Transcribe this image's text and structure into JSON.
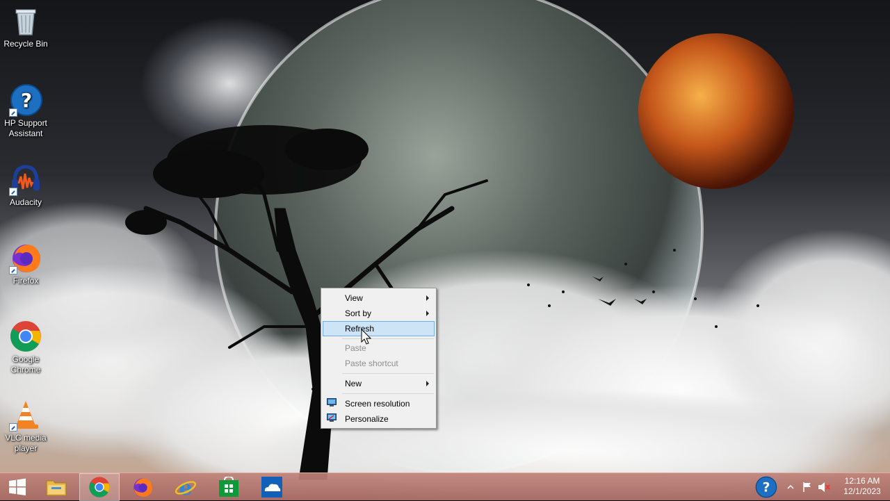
{
  "desktop": {
    "icons": [
      {
        "label": "Recycle Bin",
        "icon": "recycle-bin-icon"
      },
      {
        "label": "HP Support Assistant",
        "icon": "help-question-icon"
      },
      {
        "label": "Audacity",
        "icon": "audacity-icon"
      },
      {
        "label": "Firefox",
        "icon": "firefox-icon"
      },
      {
        "label": "Google Chrome",
        "icon": "chrome-icon"
      },
      {
        "label": "VLC media player",
        "icon": "vlc-cone-icon"
      }
    ]
  },
  "context_menu": {
    "items": [
      {
        "label": "View",
        "submenu": true,
        "disabled": false
      },
      {
        "label": "Sort by",
        "submenu": true,
        "disabled": false
      },
      {
        "label": "Refresh",
        "submenu": false,
        "disabled": false,
        "highlighted": true
      },
      {
        "label": "Paste",
        "submenu": false,
        "disabled": true
      },
      {
        "label": "Paste shortcut",
        "submenu": false,
        "disabled": true
      },
      {
        "label": "New",
        "submenu": true,
        "disabled": false
      },
      {
        "label": "Screen resolution",
        "submenu": false,
        "disabled": false,
        "icon": "screen-resolution-icon"
      },
      {
        "label": "Personalize",
        "submenu": false,
        "disabled": false,
        "icon": "personalize-icon"
      }
    ]
  },
  "taskbar": {
    "apps": [
      {
        "name": "start-button",
        "icon": "windows-logo-icon"
      },
      {
        "name": "file-explorer",
        "icon": "folder-icon"
      },
      {
        "name": "google-chrome",
        "icon": "chrome-icon",
        "active": true
      },
      {
        "name": "firefox",
        "icon": "firefox-icon"
      },
      {
        "name": "internet-explorer",
        "icon": "ie-icon"
      },
      {
        "name": "store",
        "icon": "store-icon"
      },
      {
        "name": "onedrive",
        "icon": "onedrive-icon"
      }
    ],
    "tray": {
      "icons": [
        "help-question-icon",
        "chevron-up-icon",
        "flag-icon",
        "speaker-muted-icon"
      ],
      "time": "12:16 AM",
      "date": "12/1/2023"
    }
  },
  "colors": {
    "menu_highlight": "#cde4f7",
    "menu_highlight_border": "#71aee6",
    "taskbar": "#b47c74"
  }
}
